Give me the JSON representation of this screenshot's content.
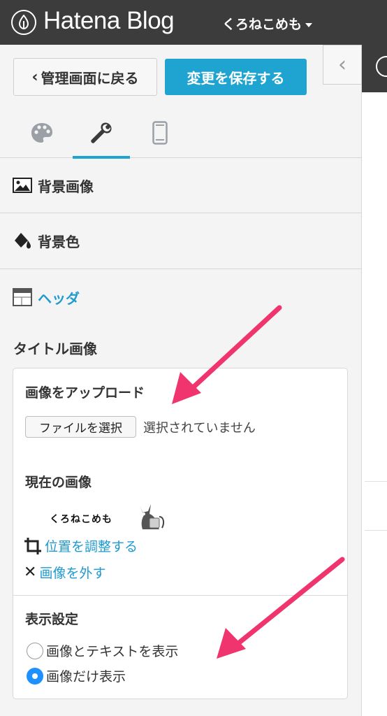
{
  "topbar": {
    "brand": "Hatena Blog",
    "blog_name": "くろねこめも"
  },
  "sidebar": {
    "back_label": "管理画面に戻る",
    "save_label": "変更を保存する",
    "tabs": [
      {
        "icon": "palette-icon",
        "active": false
      },
      {
        "icon": "wrench-icon",
        "active": true
      },
      {
        "icon": "smartphone-icon",
        "active": false
      }
    ],
    "sections": {
      "background_image": "背景画像",
      "background_color": "背景色",
      "header": "ヘッダ"
    },
    "title_image": {
      "heading": "タイトル画像",
      "upload_heading": "画像をアップロード",
      "file_button": "ファイルを選択",
      "file_status": "選択されていません",
      "current_heading": "現在の画像",
      "thumbnail_text": "くろねこめも",
      "adjust_link": "位置を調整する",
      "remove_link": "画像を外す",
      "display_heading": "表示設定",
      "options": [
        {
          "label": "画像とテキストを表示",
          "checked": false
        },
        {
          "label": "画像だけ表示",
          "checked": true
        }
      ]
    }
  },
  "colors": {
    "accent": "#1fa4d2",
    "topbar": "#3c3c3c",
    "arrow": "#f0346e"
  }
}
